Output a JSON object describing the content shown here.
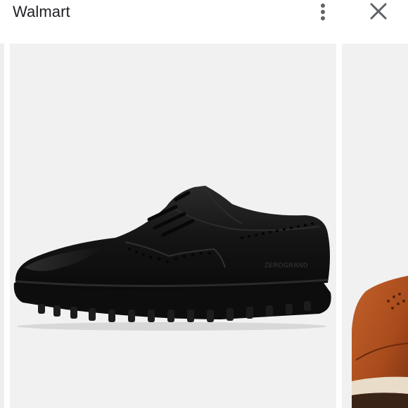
{
  "header": {
    "title": "Walmart",
    "more_icon": "more-vert-icon",
    "close_icon": "close-icon"
  },
  "gallery": {
    "main_image": "black-wingtip-oxford-shoe-image",
    "main_shoe_brand_text": "ZEROGRAND",
    "next_image": "tan-wingtip-shoe-image"
  },
  "colors": {
    "background": "#ffffff",
    "card_background": "#f1f1f1",
    "icon": "#5f6368",
    "text": "#202124"
  }
}
